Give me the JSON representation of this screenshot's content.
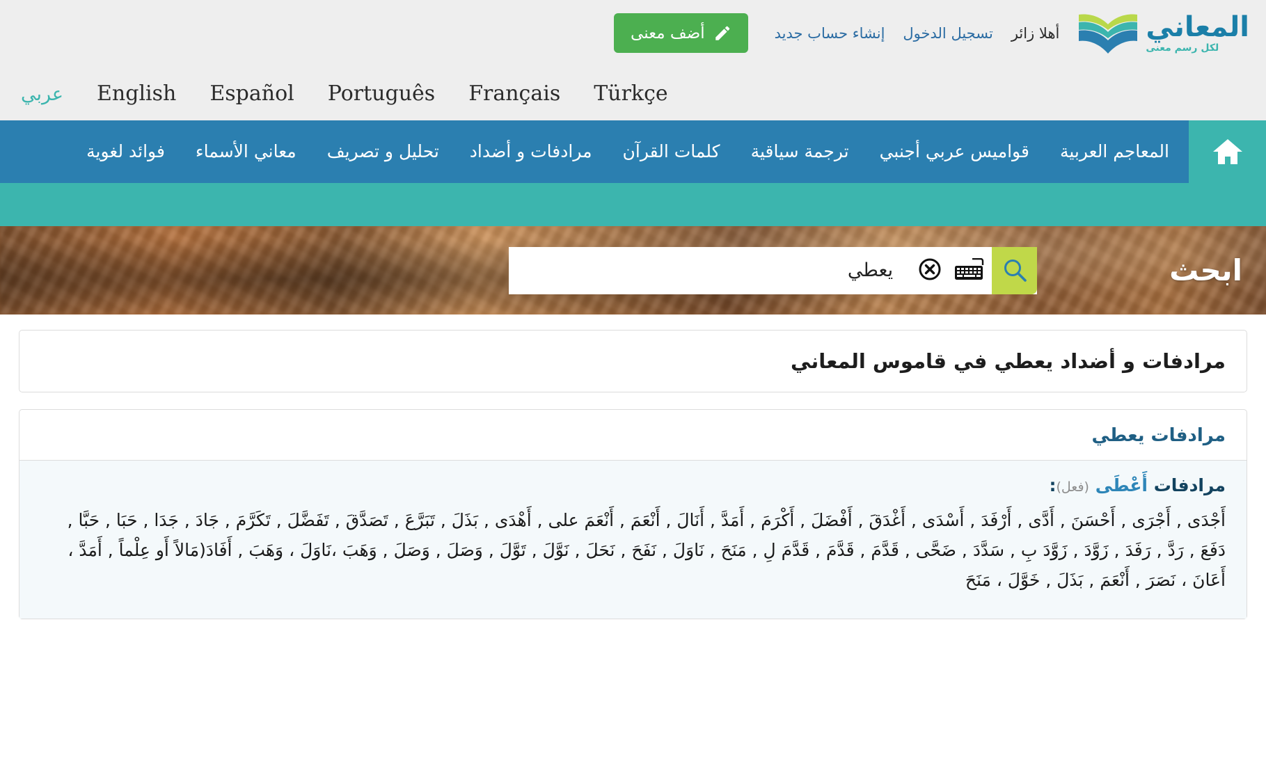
{
  "brand": {
    "title": "المعاني",
    "subtitle": "لكل رسم معنى",
    "logo_icon": "open-book-logo"
  },
  "topbar": {
    "greeting": "أهلا زائر",
    "login_label": "تسجيل الدخول",
    "register_label": "إنشاء حساب جديد",
    "add_meaning_label": "أضف معنى",
    "add_meaning_icon": "pencil-icon",
    "add_button_color": "#4caf50"
  },
  "languages": [
    {
      "label": "عربي",
      "active": true
    },
    {
      "label": "English",
      "active": false
    },
    {
      "label": "Español",
      "active": false
    },
    {
      "label": "Português",
      "active": false
    },
    {
      "label": "Français",
      "active": false
    },
    {
      "label": "Türkçe",
      "active": false
    }
  ],
  "nav": {
    "home_icon": "home-icon",
    "home_bg": "#3cb5ae",
    "bar_bg": "#2b7fb0",
    "items": [
      {
        "label": "المعاجم العربية"
      },
      {
        "label": "قواميس عربي أجنبي"
      },
      {
        "label": "ترجمة سياقية"
      },
      {
        "label": "كلمات القرآن"
      },
      {
        "label": "مرادفات و أضداد"
      },
      {
        "label": "تحليل و تصريف"
      },
      {
        "label": "معاني الأسماء"
      },
      {
        "label": "فوائد لغوية"
      }
    ]
  },
  "search": {
    "label": "ابحث",
    "value": "يعطي",
    "placeholder": "",
    "search_icon": "magnifier-icon",
    "keyboard_icon": "keyboard-icon",
    "clear_icon": "clear-circle-icon",
    "button_color": "#c0d849"
  },
  "main": {
    "page_title": "مرادفات و أضداد يعطي في قاموس المعاني",
    "section_title": "مرادفات يعطي",
    "synonyms_block": {
      "heading_prefix": "مرادفات ",
      "lemma": "أَعْطَى",
      "pos": "(فعل)",
      "heading_suffix": ":",
      "words": "أَجْدَى , أَجْرَى , أَحْسَنَ , أَدَّى , أَرْفَدَ , أَسْدَى , أَغْدَقَ , أَفْضَلَ , أَكْرَمَ , أَمَدَّ , أَنَالَ , أَنْعَمَ , أَنْعَمَ على , أَهْدَى , بَذَلَ , تَبَرَّعَ , تَصَدَّقَ , تَفَضَّلَ , تَكَرَّمَ , جَادَ , جَدَا , حَبَا , حَبَّا , دَفَعَ , رَدَّ , رَفَدَ , زَوَّدَ , زَوَّدَ بِ , سَدَّدَ , ضَحَّى , قَدَّمَ , قَدَّمَ , قَدَّمَ لِ , مَنَحَ , نَاوَلَ , نَفَحَ , نَحَلَ , نَوَّلَ , تَوَّلَ , وَصَلَ , وَصَلَ , وَهَبَ ،نَاوَلَ ، وَهَبَ , أَفَادَ(مَالاً أَو عِلْماً , أَمَدَّ ، أَعَانَ ، نَصَرَ , أَنْعَمَ , بَذَلَ , خَوَّلَ ، مَنَحَ"
    }
  }
}
